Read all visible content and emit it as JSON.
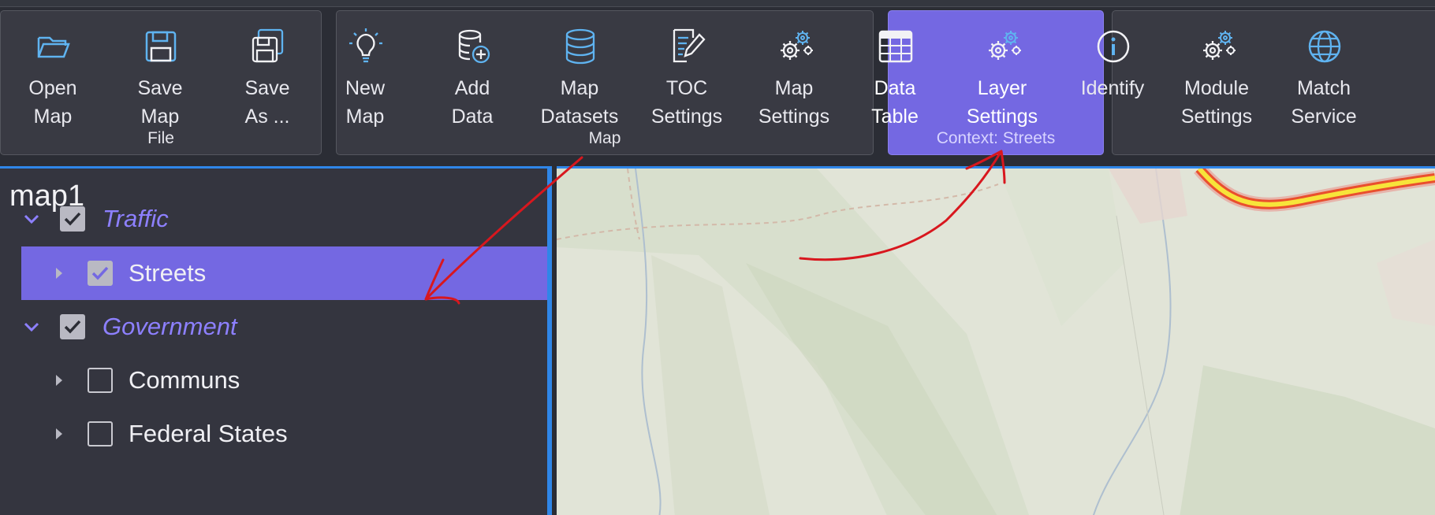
{
  "ribbon": {
    "file_group": {
      "label": "File",
      "buttons": [
        {
          "id": "open-map",
          "label": "Open\nMap",
          "icon": "folder-open-icon"
        },
        {
          "id": "save-map",
          "label": "Save\nMap",
          "icon": "floppy-disk-icon"
        },
        {
          "id": "save-as",
          "label": "Save\nAs ...",
          "icon": "floppy-disks-icon"
        }
      ]
    },
    "map_group": {
      "label": "Map",
      "buttons": [
        {
          "id": "new-map",
          "label": "New\nMap",
          "icon": "lightbulb-icon"
        },
        {
          "id": "add-data",
          "label": "Add\nData",
          "icon": "database-add-icon"
        },
        {
          "id": "map-datasets",
          "label": "Map\nDatasets",
          "icon": "database-icon"
        },
        {
          "id": "toc-settings",
          "label": "TOC\nSettings",
          "icon": "document-edit-icon"
        },
        {
          "id": "map-settings",
          "label": "Map\nSettings",
          "icon": "gears-icon"
        }
      ]
    },
    "context_group": {
      "label": "Context: Streets",
      "buttons": [
        {
          "id": "data-table",
          "label": "Data\nTable",
          "icon": "table-icon"
        },
        {
          "id": "layer-settings",
          "label": "Layer\nSettings",
          "icon": "gears-icon"
        }
      ]
    },
    "tools_group": {
      "buttons": [
        {
          "id": "identify",
          "label": "Identify",
          "icon": "info-icon"
        },
        {
          "id": "module-settings",
          "label": "Module\nSettings",
          "icon": "gears-icon"
        },
        {
          "id": "match-service",
          "label": "Match\nService",
          "icon": "globe-icon"
        }
      ]
    }
  },
  "toc": {
    "map_name": "map1",
    "rows": [
      {
        "label": "Traffic",
        "kind": "group",
        "expanded": true,
        "checked": true
      },
      {
        "label": "Streets",
        "kind": "layer",
        "expanded": false,
        "checked": true,
        "selected": true
      },
      {
        "label": "Government",
        "kind": "group",
        "expanded": true,
        "checked": true
      },
      {
        "label": "Communs",
        "kind": "layer",
        "expanded": false,
        "checked": false
      },
      {
        "label": "Federal States",
        "kind": "layer",
        "expanded": false,
        "checked": false
      }
    ]
  },
  "colors": {
    "accent": "#7468e2",
    "selection_border": "#2f86e8",
    "annotation": "#d8171e",
    "icon_blue": "#5fb3f0"
  }
}
